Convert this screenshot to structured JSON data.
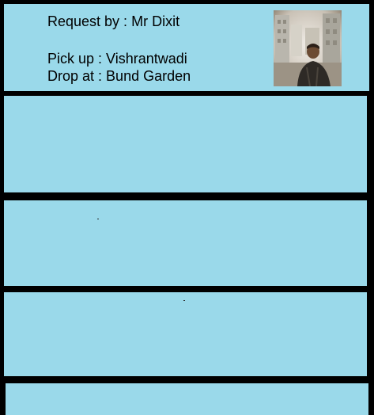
{
  "request": {
    "requested_by_label": "Request by :",
    "requested_by_name": "Mr Dixit",
    "pickup_label": "Pick up :",
    "pickup_location": "Vishrantwadi",
    "drop_label": "Drop at :",
    "drop_location": "Bund Garden",
    "avatar_icon": "person-photo-icon"
  },
  "colors": {
    "card_background": "#9ad9ea",
    "separator": "#000000",
    "text": "#000000"
  }
}
